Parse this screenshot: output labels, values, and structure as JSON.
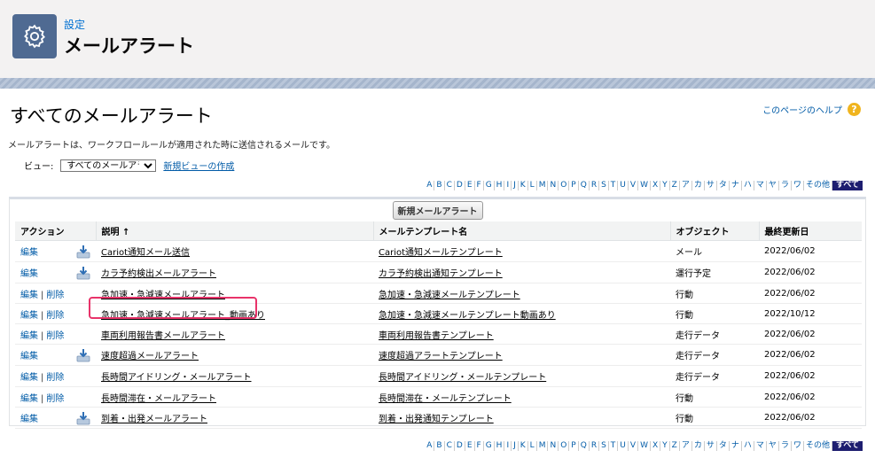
{
  "header": {
    "breadcrumb": "設定",
    "title": "メールアラート",
    "icon": "gear-icon"
  },
  "page": {
    "title": "すべてのメールアラート",
    "help_link": "このページのヘルプ",
    "help_icon": "?",
    "description": "メールアラートは、ワークフロールールが適用された時に送信されるメールです。"
  },
  "view": {
    "label": "ビュー:",
    "selected": "すべてのメールアラート",
    "create_link": "新規ビューの作成"
  },
  "alpha_filter": [
    "A",
    "B",
    "C",
    "D",
    "E",
    "F",
    "G",
    "H",
    "I",
    "J",
    "K",
    "L",
    "M",
    "N",
    "O",
    "P",
    "Q",
    "R",
    "S",
    "T",
    "U",
    "V",
    "W",
    "X",
    "Y",
    "Z",
    "ア",
    "カ",
    "サ",
    "タ",
    "ナ",
    "ハ",
    "マ",
    "ヤ",
    "ラ",
    "ワ",
    "その他",
    "すべて"
  ],
  "alpha_selected": "すべて",
  "table": {
    "new_button": "新規メールアラート",
    "columns": [
      "アクション",
      "説明 ↑",
      "メールテンプレート名",
      "オブジェクト",
      "最終更新日"
    ],
    "rows": [
      {
        "edit": "編集",
        "delete": "",
        "has_icon": true,
        "description": "Cariot通知メール送信",
        "template": "Cariot通知メールテンプレート",
        "object": "メール",
        "date": "2022/06/02"
      },
      {
        "edit": "編集",
        "delete": "",
        "has_icon": true,
        "description": "カラ予約検出メールアラート",
        "template": "カラ予約検出通知テンプレート",
        "object": "運行予定",
        "date": "2022/06/02"
      },
      {
        "edit": "編集",
        "delete": "削除",
        "has_icon": false,
        "description": "急加速・急減速メールアラート",
        "template": "急加速・急減速メールテンプレート",
        "object": "行動",
        "date": "2022/06/02"
      },
      {
        "edit": "編集",
        "delete": "削除",
        "has_icon": false,
        "description": "急加速・急減速メールアラート_動画あり",
        "template": "急加速・急減速メールテンプレート動画あり",
        "object": "行動",
        "date": "2022/10/12"
      },
      {
        "edit": "編集",
        "delete": "削除",
        "has_icon": false,
        "description": "車両利用報告書メールアラート",
        "template": "車両利用報告書テンプレート",
        "object": "走行データ",
        "date": "2022/06/02"
      },
      {
        "edit": "編集",
        "delete": "",
        "has_icon": true,
        "description": "速度超過メールアラート",
        "template": "速度超過アラートテンプレート",
        "object": "走行データ",
        "date": "2022/06/02"
      },
      {
        "edit": "編集",
        "delete": "削除",
        "has_icon": false,
        "description": "長時間アイドリング・メールアラート",
        "template": "長時間アイドリング・メールテンプレート",
        "object": "走行データ",
        "date": "2022/06/02"
      },
      {
        "edit": "編集",
        "delete": "削除",
        "has_icon": false,
        "description": "長時間滞在・メールアラート",
        "template": "長時間滞在・メールテンプレート",
        "object": "行動",
        "date": "2022/06/02"
      },
      {
        "edit": "編集",
        "delete": "",
        "has_icon": true,
        "description": "到着・出発メールアラート",
        "template": "到着・出発通知テンプレート",
        "object": "行動",
        "date": "2022/06/02"
      }
    ]
  },
  "colors": {
    "header_bg": "#f3f2f2",
    "icon_bg": "#4f6a92",
    "link": "#015ba7",
    "highlight": "#e8336a",
    "selected_letter_bg": "#1e1e70"
  }
}
